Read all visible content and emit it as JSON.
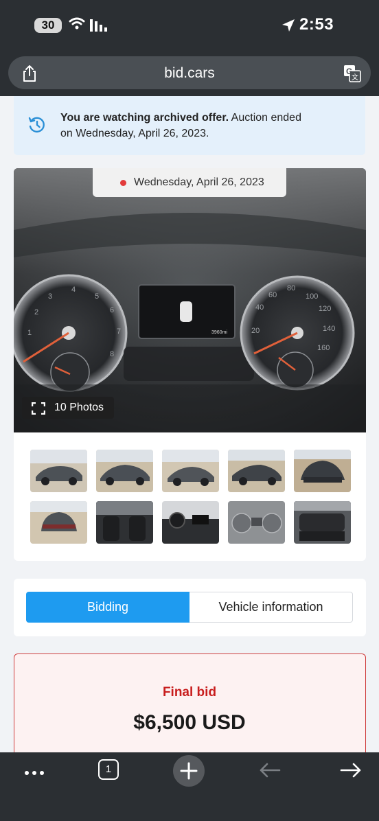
{
  "status_bar": {
    "battery": "30",
    "time": "2:53"
  },
  "browser": {
    "url": "bid.cars",
    "open_tabs": "1"
  },
  "archive_banner": {
    "bold_text": "You are watching archived offer.",
    "text_line1": " Auction ended",
    "text_line2": "on Wednesday, April 26, 2023."
  },
  "gallery": {
    "date": "Wednesday, April 26, 2023",
    "photos_label": "10 Photos",
    "thumbnails": [
      "exterior-front-left",
      "exterior-side",
      "exterior-rear-left",
      "exterior-damaged-front",
      "exterior-front-damage",
      "exterior-rear",
      "interior-front-seats",
      "interior-dashboard",
      "instrument-cluster",
      "interior-rear-seats"
    ]
  },
  "tabs": {
    "bidding": "Bidding",
    "vehicle_information": "Vehicle information",
    "active": "bidding"
  },
  "final_bid": {
    "label": "Final bid",
    "amount": "$6,500 USD"
  },
  "colors": {
    "accent": "#1e9bf0",
    "final_bid_red": "#c81e1e",
    "banner_bg": "#e4f0fb",
    "chrome": "#2b2f33"
  }
}
